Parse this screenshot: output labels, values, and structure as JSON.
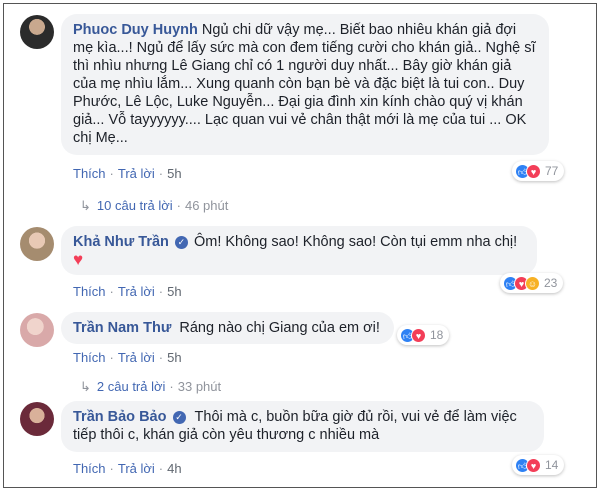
{
  "comments": [
    {
      "author": "Phuoc Duy Huynh",
      "verified": false,
      "text": "Ngủ chi dữ vậy mẹ... Biết bao nhiêu khán giả đợi mẹ kìa...! Ngủ để lấy sức mà con đem tiếng cười cho khán giả.. Nghệ sĩ thì nhìu nhưng Lê Giang chỉ có 1 người duy nhất... Bây giờ khán giả của mẹ nhìu lắm... Xung quanh còn bạn bè và đặc biệt là tui con.. Duy Phước, Lê Lộc, Luke Nguyễn... Đại gia đình xin kính chào quý vị khán giả... Vỗ tayyyyyy.... Lạc quan vui vẻ chân thật mới là mẹ của tui ... OK chị Mẹ...",
      "like_label": "Thích",
      "reply_label": "Trả lời",
      "time": "5h",
      "reaction_count": "77",
      "reactions": [
        "like",
        "love"
      ]
    },
    {
      "author": "Khả Như Trần",
      "verified": true,
      "text": "Ôm! Không sao! Không sao! Còn tụi emm nha chị!",
      "emoji": "heart",
      "like_label": "Thích",
      "reply_label": "Trả lời",
      "time": "5h",
      "reaction_count": "23",
      "reactions": [
        "like",
        "love",
        "haha"
      ]
    },
    {
      "author": "Trần Nam Thư",
      "verified": false,
      "text": "Ráng nào chị Giang của em ơi!",
      "like_label": "Thích",
      "reply_label": "Trả lời",
      "time": "5h",
      "reaction_count": "18",
      "reactions": [
        "like",
        "love"
      ]
    },
    {
      "author": "Trần Bảo Bảo",
      "verified": true,
      "text": "Thôi mà c, buồn bữa giờ đủ rồi, vui vẻ để làm việc tiếp thôi c, khán giả còn yêu thương c nhiều mà",
      "like_label": "Thích",
      "reply_label": "Trả lời",
      "time": "4h",
      "reaction_count": "14",
      "reactions": [
        "like",
        "love"
      ]
    }
  ],
  "reply_threads": [
    {
      "label": "10 câu trả lời",
      "time": "46 phút"
    },
    {
      "label": "2 câu trả lời",
      "time": "33 phút"
    }
  ],
  "colors": {
    "link": "#385898",
    "bubble": "#f2f3f5",
    "like": "#2e81f4",
    "love": "#f33e58",
    "haha": "#f7b125"
  }
}
